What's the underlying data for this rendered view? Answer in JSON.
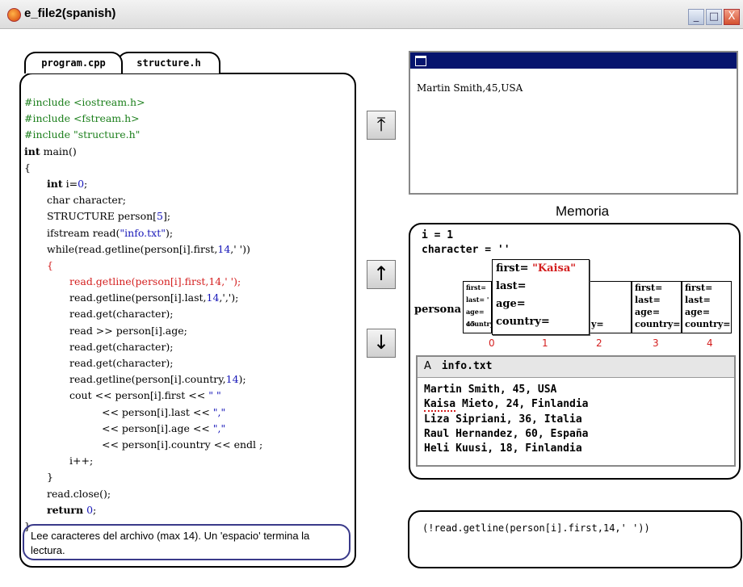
{
  "window": {
    "title": "e_file2(spanish)",
    "buttons": {
      "minimize": "_",
      "maximize": "□",
      "close": "X"
    }
  },
  "tabs": [
    "program.cpp",
    "structure.h"
  ],
  "code_lines": [
    {
      "text": "#include <iostream.h>",
      "style": "green",
      "indent": 0
    },
    {
      "text": "#include <fstream.h>",
      "style": "green",
      "indent": 0
    },
    {
      "text": "#include \"structure.h\"",
      "style": "green",
      "indent": 0
    },
    {
      "text": "int main()",
      "style": "plain",
      "indent": 0,
      "bold_prefix": "int"
    },
    {
      "text": "{",
      "style": "plain",
      "indent": 0
    },
    {
      "text": "int i=0;",
      "style": "plain",
      "indent": 1,
      "bold_prefix": "int"
    },
    {
      "text": "char character;",
      "style": "plain",
      "indent": 1
    },
    {
      "text": "STRUCTURE person[5];",
      "style": "plain",
      "indent": 1
    },
    {
      "text": "ifstream read(\"info.txt\");",
      "style": "plain",
      "indent": 1
    },
    {
      "text": "while(read.getline(person[i].first,14,' '))",
      "style": "plain",
      "indent": 1
    },
    {
      "text": "{",
      "style": "red",
      "indent": 1
    },
    {
      "text": "read.getline(person[i].first,14,' ');",
      "style": "red",
      "indent": 2
    },
    {
      "text": "read.getline(person[i].last,14,',');",
      "style": "plain",
      "indent": 2
    },
    {
      "text": "read.get(character);",
      "style": "plain",
      "indent": 2
    },
    {
      "text": "read >> person[i].age;",
      "style": "plain",
      "indent": 2
    },
    {
      "text": "read.get(character);",
      "style": "plain",
      "indent": 2
    },
    {
      "text": "read.get(character);",
      "style": "plain",
      "indent": 2
    },
    {
      "text": "read.getline(person[i].country,14);",
      "style": "plain",
      "indent": 2
    },
    {
      "text": "cout << person[i].first << \" \"",
      "style": "plain",
      "indent": 2
    },
    {
      "text": "<< person[i].last << \",\"",
      "style": "plain",
      "indent": 3
    },
    {
      "text": "<< person[i].age << \",\"",
      "style": "plain",
      "indent": 3
    },
    {
      "text": "<< person[i].country << endl ;",
      "style": "plain",
      "indent": 3
    },
    {
      "text": "i++;",
      "style": "plain",
      "indent": 2
    },
    {
      "text": "}",
      "style": "plain",
      "indent": 1
    },
    {
      "text": "read.close();",
      "style": "plain",
      "indent": 1
    },
    {
      "text": "return 0;",
      "style": "plain",
      "indent": 1,
      "bold_prefix": "return"
    },
    {
      "text": "}",
      "style": "plain",
      "indent": 0
    }
  ],
  "hint": "Lee caracteres del archivo (max 14). Un 'espacio' termina la lectura.",
  "controls": {
    "to_top": "⤒",
    "step_up": "↑",
    "step_down": "↓"
  },
  "output": {
    "text": "Martin Smith,45,USA"
  },
  "memory": {
    "label": "Memoria",
    "i_label": "i = 1",
    "character_label": "character = ''",
    "array_name": "persona",
    "cells": [
      {
        "index": "0",
        "fields": [
          "first=",
          "last= '",
          "age= 45",
          "country"
        ]
      },
      {
        "index": "1",
        "fields": [
          "",
          "",
          "",
          ""
        ]
      },
      {
        "index": "2",
        "fields": [
          "",
          "",
          "",
          "y="
        ]
      },
      {
        "index": "3",
        "fields": [
          "first=",
          "last=",
          "age=",
          "country="
        ]
      },
      {
        "index": "4",
        "fields": [
          "first=",
          "last=",
          "age=",
          "country="
        ]
      }
    ],
    "popup": {
      "first_label": "first=",
      "first_value": "\"Kaisa\"",
      "last_label": "last=",
      "age_label": "age=",
      "country_label": "country="
    }
  },
  "file": {
    "icon": "A",
    "name": "info.txt",
    "lines": [
      "Martin Smith, 45, USA",
      "Kaisa Mieto, 24, Finlandia",
      "Liza Sipriani, 36, Italia",
      "Raul Hernandez, 60, España",
      "Heli Kuusi, 18, Finlandia"
    ]
  },
  "condition": "(!read.getline(person[i].first,14,' '))",
  "colors": {
    "string": "#1515b8",
    "include": "#1b7f1b",
    "highlight": "#d41f1f",
    "title_bar": "#06146e"
  }
}
